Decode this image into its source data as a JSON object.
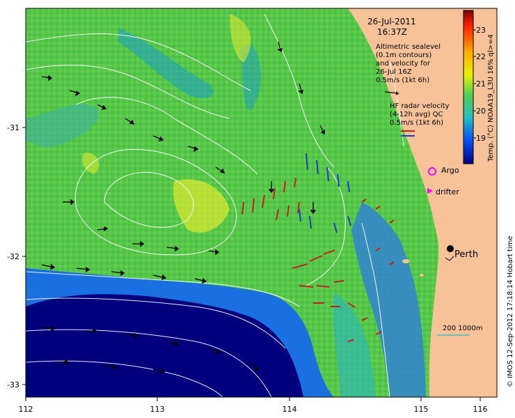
{
  "header": {
    "date": "26-Jul-2011",
    "time": "16:37Z"
  },
  "altimetry": {
    "lines": [
      "Altimetric sealevel",
      "(0.1m contours)",
      "and velocity for",
      "26-Jul 16Z",
      "0.5m/s (1kt 6h)"
    ]
  },
  "radar": {
    "lines": [
      "HF radar velocity",
      "(4-12h avg) QC",
      "0.5m/s (1kt 6h)"
    ]
  },
  "legend": {
    "argo": "Argo",
    "drifter": "drifter",
    "argo_color": "#ff00ff",
    "drifter_color": "#ff00ff"
  },
  "place": {
    "perth": "Perth"
  },
  "scale": {
    "label": "200  1000m"
  },
  "colorbar": {
    "label": "Temp. (°C) NOAA19_L3U 16% ql>=4",
    "ticks": [
      "23",
      "22",
      "21",
      "20",
      "19"
    ]
  },
  "credit": "© IMOS 12-Sep-2012 17:18:14 Hobart time",
  "axes": {
    "x_ticks": [
      "112",
      "113",
      "114",
      "115",
      "116"
    ],
    "y_ticks": [
      "-31",
      "-32",
      "-33"
    ]
  },
  "colors": {
    "land": "#f7c298",
    "deep_water": "#00007f",
    "warm_sst": "#55c84a",
    "contour": "#ffffff",
    "radar_red": "#c81e1e",
    "radar_blue": "#1e3cc8"
  }
}
